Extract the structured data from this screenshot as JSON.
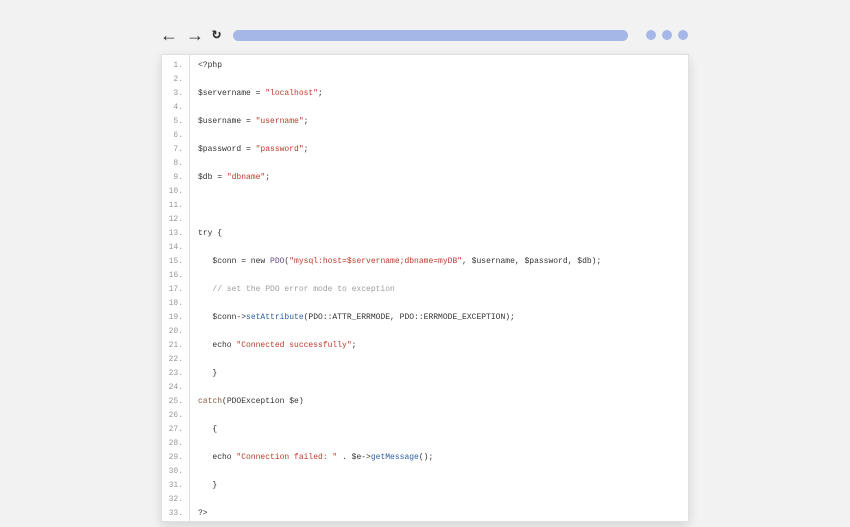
{
  "code_lines": [
    [
      [
        "<?php",
        ""
      ]
    ],
    [],
    [
      [
        "$servername = ",
        ""
      ],
      [
        "\"localhost\"",
        "str"
      ],
      [
        ";",
        ""
      ]
    ],
    [],
    [
      [
        "$username = ",
        ""
      ],
      [
        "\"username\"",
        "str"
      ],
      [
        ";",
        ""
      ]
    ],
    [],
    [
      [
        "$password = ",
        ""
      ],
      [
        "\"password\"",
        "str"
      ],
      [
        ";",
        ""
      ]
    ],
    [],
    [
      [
        "$db = ",
        ""
      ],
      [
        "\"dbname\"",
        "str"
      ],
      [
        ";",
        ""
      ]
    ],
    [],
    [],
    [],
    [
      [
        "try {",
        ""
      ]
    ],
    [],
    [
      [
        "   $conn = new ",
        ""
      ],
      [
        "PDO",
        "cls"
      ],
      [
        "(",
        ""
      ],
      [
        "\"mysql:host=$servername;dbname=myDB\"",
        "str"
      ],
      [
        ", $username, $password, $db);",
        ""
      ]
    ],
    [],
    [
      [
        "   // set the PDO error mode to exception",
        "cmt"
      ]
    ],
    [],
    [
      [
        "   $conn->",
        ""
      ],
      [
        "setAttribute",
        "mth"
      ],
      [
        "(PDO::ATTR_ERRMODE, PDO::ERRMODE_EXCEPTION);",
        ""
      ]
    ],
    [],
    [
      [
        "   echo ",
        ""
      ],
      [
        "\"Connected successfully\"",
        "str"
      ],
      [
        ";",
        ""
      ]
    ],
    [],
    [
      [
        "   }",
        ""
      ]
    ],
    [],
    [
      [
        "catch",
        "kw"
      ],
      [
        "(PDOException $e)",
        ""
      ]
    ],
    [],
    [
      [
        "   {",
        ""
      ]
    ],
    [],
    [
      [
        "   echo ",
        ""
      ],
      [
        "\"Connection failed: \"",
        "str"
      ],
      [
        " . $e->",
        ""
      ],
      [
        "getMessage",
        "mth"
      ],
      [
        "();",
        ""
      ]
    ],
    [],
    [
      [
        "   }",
        ""
      ]
    ],
    [],
    [
      [
        "?>",
        ""
      ]
    ]
  ]
}
